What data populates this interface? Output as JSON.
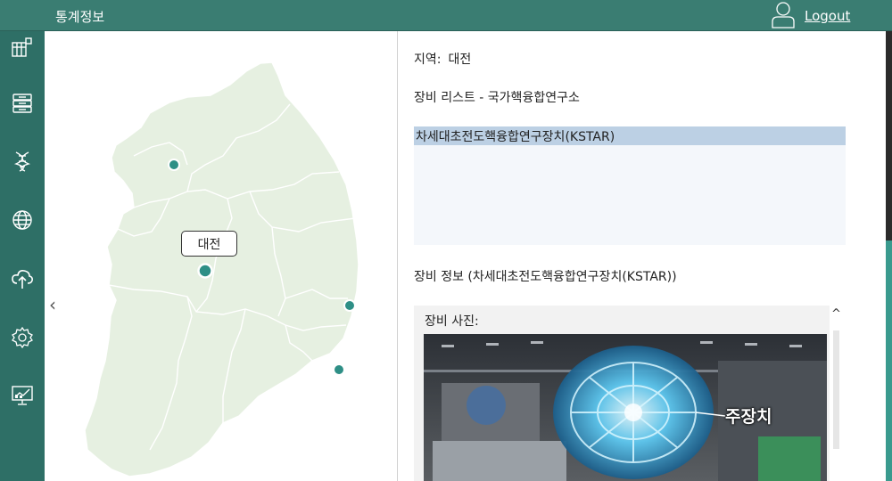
{
  "header": {
    "title": "통계정보",
    "user_icon": "user-icon",
    "logout_label": "Logout"
  },
  "sidebar": {
    "items": [
      {
        "name": "dashboard-grid-icon"
      },
      {
        "name": "server-stack-icon"
      },
      {
        "name": "dna-icon"
      },
      {
        "name": "globe-network-icon"
      },
      {
        "name": "cloud-upload-icon"
      },
      {
        "name": "settings-gear-icon"
      },
      {
        "name": "monitor-chart-icon"
      }
    ]
  },
  "map": {
    "selected_region": "대전",
    "prev_arrow": "‹",
    "marker_color": "#2e8f86",
    "land_color": "#e6f0e1"
  },
  "details": {
    "region_label": "지역:",
    "region_value": "대전",
    "list_title": "장비 리스트 - 국가핵융합연구소",
    "equipment": [
      {
        "label": "차세대초전도핵융합연구장치(KSTAR)",
        "selected": true
      }
    ],
    "info_title": "장비 정보 (차세대초전도핵융합연구장치(KSTAR))",
    "photo_label": "장비 사진:",
    "photo_caption": "주장치",
    "scroll_up": "^"
  },
  "colors": {
    "topbar": "#3a7d72",
    "sidebar": "#2e6f66",
    "selection": "#bcd0e4"
  }
}
